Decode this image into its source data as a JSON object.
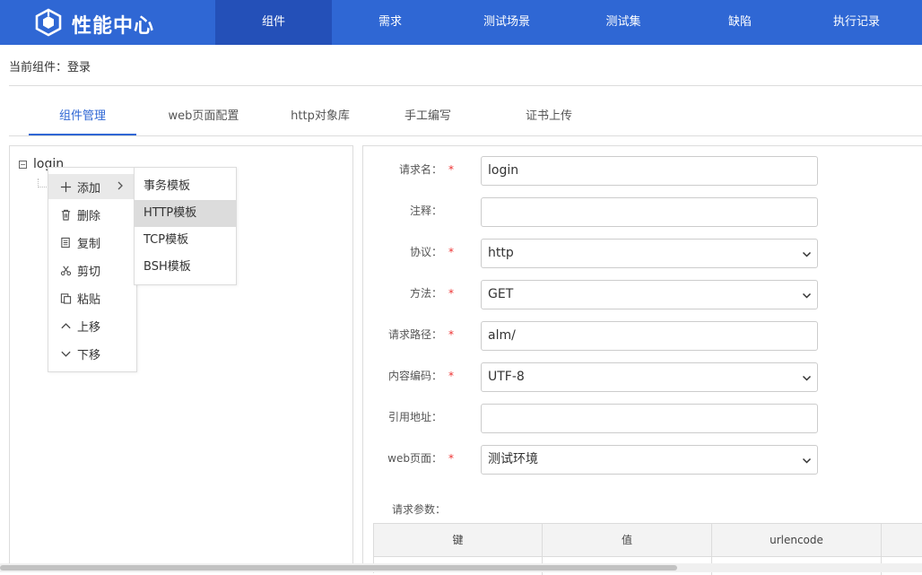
{
  "app": {
    "title": "性能中心"
  },
  "nav": {
    "items": [
      {
        "label": "组件"
      },
      {
        "label": "需求"
      },
      {
        "label": "测试场景"
      },
      {
        "label": "测试集"
      },
      {
        "label": "缺陷"
      },
      {
        "label": "执行记录"
      }
    ],
    "active": 0
  },
  "breadcrumb": {
    "text": "当前组件：登录"
  },
  "tabs": {
    "items": [
      {
        "label": "组件管理"
      },
      {
        "label": "web页面配置"
      },
      {
        "label": "http对象库"
      },
      {
        "label": "手工编写"
      },
      {
        "label": "证书上传"
      }
    ],
    "active": 0
  },
  "tree": {
    "root_label": "login",
    "toggle_symbol": "−"
  },
  "context_menu": {
    "items": [
      {
        "label": "添加",
        "icon": "plus-icon"
      },
      {
        "label": "删除",
        "icon": "trash-icon"
      },
      {
        "label": "复制",
        "icon": "copy-icon"
      },
      {
        "label": "剪切",
        "icon": "scissors-icon"
      },
      {
        "label": "粘贴",
        "icon": "paste-icon"
      },
      {
        "label": "上移",
        "icon": "chevron-up-icon"
      },
      {
        "label": "下移",
        "icon": "chevron-down-icon"
      }
    ],
    "highlighted": 0
  },
  "submenu": {
    "items": [
      {
        "label": "事务模板"
      },
      {
        "label": "HTTP模板"
      },
      {
        "label": "TCP模板"
      },
      {
        "label": "BSH模板"
      }
    ],
    "highlighted": 1
  },
  "form": {
    "required_mark": "*",
    "request_name": {
      "label": "请求名：",
      "value": "login",
      "required": true
    },
    "comment": {
      "label": "注释：",
      "value": "",
      "required": false
    },
    "protocol": {
      "label": "协议：",
      "value": "http",
      "required": true
    },
    "method": {
      "label": "方法：",
      "value": "GET",
      "required": true
    },
    "path": {
      "label": "请求路径：",
      "value": "alm/",
      "required": true
    },
    "encoding": {
      "label": "内容编码：",
      "value": "UTF-8",
      "required": true
    },
    "ref_address": {
      "label": "引用地址：",
      "value": "",
      "required": false
    },
    "web_page": {
      "label": "web页面：",
      "value": "测试环境",
      "required": true
    }
  },
  "params": {
    "label": "请求参数：",
    "columns": [
      "键",
      "值",
      "urlencode",
      ""
    ]
  },
  "colors": {
    "primary": "#2f67d4",
    "nav_active": "#2450b8",
    "required": "#e33333",
    "border": "#dcdcdc"
  }
}
